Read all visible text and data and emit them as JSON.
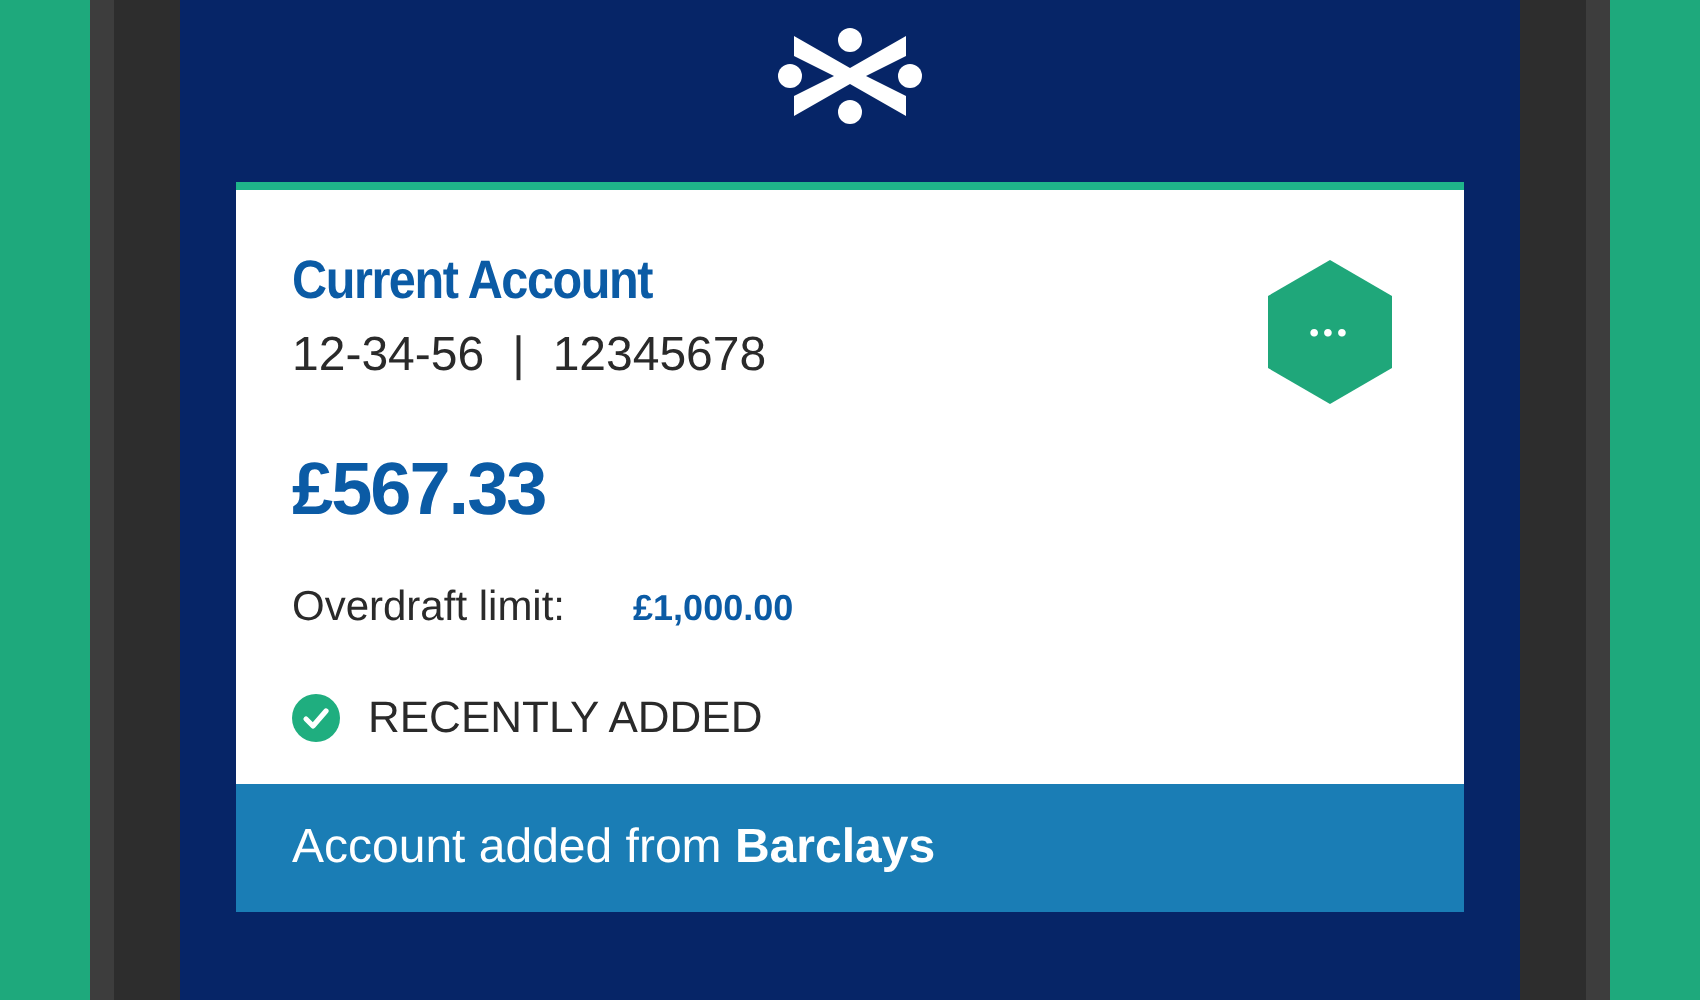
{
  "account": {
    "name": "Current Account",
    "sort_code": "12-34-56",
    "separator": "|",
    "account_number": "12345678",
    "balance": "£567.33",
    "overdraft_label": "Overdraft limit:",
    "overdraft_value": "£1,000.00",
    "status": {
      "kind": "verified",
      "label": "RECENTLY ADDED"
    },
    "more_button": "•••",
    "footer": "Account added from **Barclays**"
  }
}
